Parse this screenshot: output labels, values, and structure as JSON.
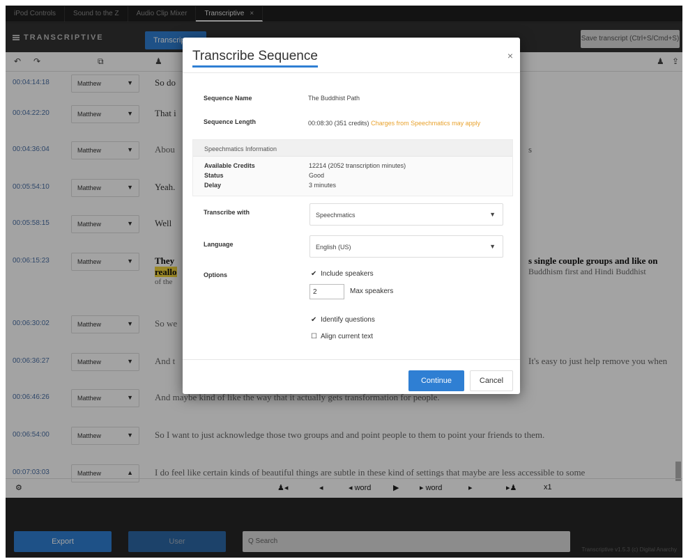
{
  "tabs": [
    {
      "label": "iPod Controls"
    },
    {
      "label": "Sound to the Z"
    },
    {
      "label": "Audio Clip Mixer"
    },
    {
      "label": "Transcriptive",
      "close": "×"
    }
  ],
  "app": {
    "logo": "TRANSCRIPTIVE",
    "tab_transcript": "Transcript",
    "save_button": "Save transcript (Ctrl+S/Cmd+S)"
  },
  "transcript_rows": [
    {
      "timecode": "00:04:14:18",
      "speaker": "Matthew",
      "text": "So do"
    },
    {
      "timecode": "00:04:22:20",
      "speaker": "Matthew",
      "text": "That i"
    },
    {
      "timecode": "00:04:36:04",
      "speaker": "Matthew",
      "text": "Abou"
    },
    {
      "timecode": "00:05:54:10",
      "speaker": "Matthew",
      "text": "Yeah."
    },
    {
      "timecode": "00:05:58:15",
      "speaker": "Matthew",
      "text": "Well"
    },
    {
      "timecode": "00:06:15:23",
      "speaker": "Matthew",
      "text": "They",
      "text2": "reallo",
      "text3": "of the"
    },
    {
      "timecode": "00:06:30:02",
      "speaker": "Matthew",
      "text": "So we"
    },
    {
      "timecode": "00:06:36:27",
      "speaker": "Matthew",
      "text": "And t"
    },
    {
      "timecode": "00:06:46:26",
      "speaker": "Matthew",
      "text": "And maybe kind of like the way that it actually gets transformation for people."
    },
    {
      "timecode": "00:06:54:00",
      "speaker": "Matthew",
      "text": "So I want to just acknowledge those two groups and and point people to them to point your friends to them."
    },
    {
      "timecode": "00:07:03:03",
      "speaker": "Matthew",
      "text": "I do feel like certain kinds of beautiful things are subtle in these kind of settings that maybe are less accessible to some"
    }
  ],
  "right_fragments": {
    "row6_line1": "s single couple groups and like on",
    "row6_line2": "Buddhism first and Hindi Buddhist",
    "row8_line1": "It's easy to just help remove you when",
    "row3_line1": "s"
  },
  "player": {
    "speaker_prev": "♟◂",
    "back": "◂",
    "prev_word": "◂ word",
    "play": "▶",
    "next_word": "▸ word",
    "forward": "▸",
    "speaker_next": "▸♟",
    "speed": "x1"
  },
  "bottom": {
    "export": "Export",
    "user": "User",
    "search_placeholder": "Q  Search",
    "version": "Transcriptive v1.5.3 (c) Digital Anarchy"
  },
  "modal": {
    "title": "Transcribe Sequence",
    "close": "×",
    "sequence_name_label": "Sequence Name",
    "sequence_name_value": "The Buddhist Path",
    "sequence_length_label": "Sequence Length",
    "sequence_length_value": "00:08:30 (351 credits)",
    "sequence_length_warning": "Charges from Speechmatics may apply",
    "info_header": "Speechmatics Information",
    "available_credits_label": "Available Credits",
    "available_credits_value": "12214 (2052 transcription minutes)",
    "status_label": "Status",
    "status_value": "Good",
    "delay_label": "Delay",
    "delay_value": "3 minutes",
    "transcribe_with_label": "Transcribe with",
    "transcribe_with_value": "Speechmatics",
    "language_label": "Language",
    "language_value": "English (US)",
    "options_label": "Options",
    "include_speakers": "Include speakers",
    "max_speakers_value": "2",
    "max_speakers_label": "Max speakers",
    "identify_questions": "Identify questions",
    "align_current_text": "Align current text",
    "continue": "Continue",
    "cancel": "Cancel"
  }
}
